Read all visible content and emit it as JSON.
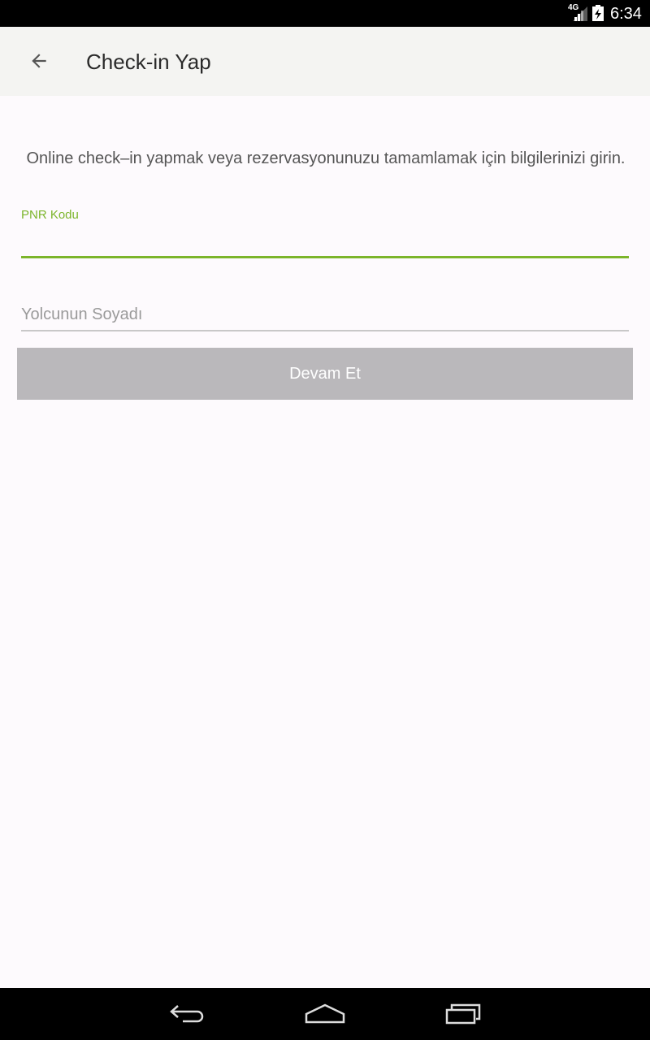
{
  "status_bar": {
    "network": "4G",
    "time": "6:34"
  },
  "app_bar": {
    "title": "Check-in Yap",
    "back_icon": "arrow-left-icon"
  },
  "intro_text": "Online check–in yapmak veya rezervasyonunuzu tamamlamak için bilgilerinizi girin.",
  "form": {
    "pnr": {
      "label": "PNR Kodu",
      "value": ""
    },
    "surname": {
      "placeholder": "Yolcunun Soyadı",
      "value": ""
    },
    "submit_label": "Devam Et"
  },
  "nav_bar": {
    "icons": [
      "back-icon",
      "home-icon",
      "recents-icon"
    ]
  },
  "colors": {
    "accent": "#7cb52b",
    "button_disabled": "#bab8bb",
    "background": "#fdfafd"
  }
}
